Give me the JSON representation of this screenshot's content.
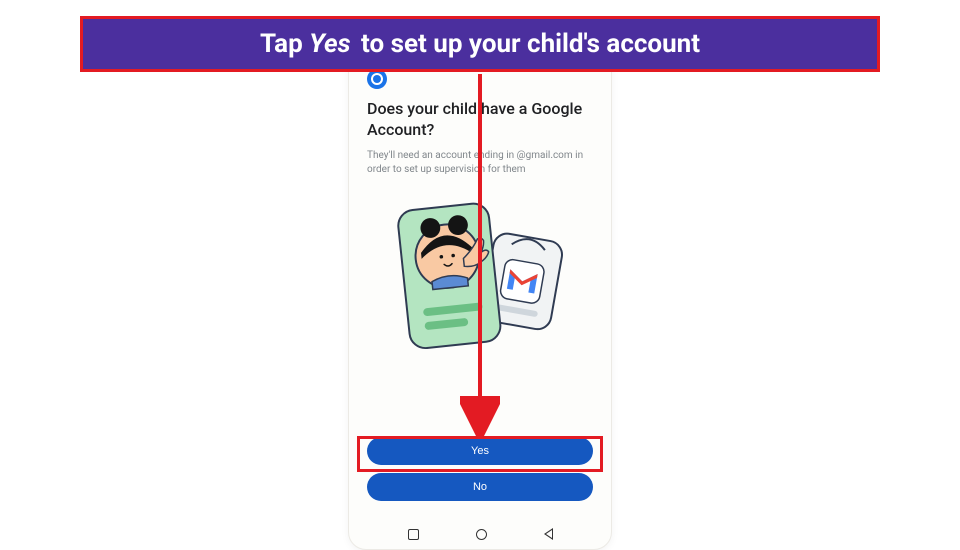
{
  "banner": {
    "prefix": "Tap",
    "emphasis": "Yes",
    "suffix": "to set up your child's account"
  },
  "screen": {
    "title": "Does your child have a Google Account?",
    "subtitle": "They'll need an account ending in @gmail.com in order to set up supervision for them",
    "buttons": {
      "yes": "Yes",
      "no": "No"
    }
  },
  "colors": {
    "accent": "#e31b23",
    "banner_bg": "#4b2f9e",
    "button_bg": "#1558c0"
  }
}
